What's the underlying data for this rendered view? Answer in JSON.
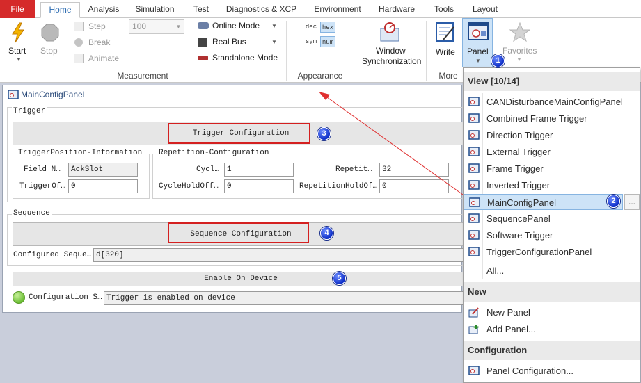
{
  "tabs": [
    "File",
    "Home",
    "Analysis",
    "Simulation",
    "Test",
    "Diagnostics & XCP",
    "Environment",
    "Hardware",
    "Tools",
    "Layout"
  ],
  "ribbon": {
    "start": "Start",
    "stop": "Stop",
    "step": "Step",
    "break": "Break",
    "animate": "Animate",
    "speed_value": "100",
    "online_mode": "Online Mode",
    "real_bus": "Real Bus",
    "standalone_mode": "Standalone Mode",
    "group_measurement": "Measurement",
    "fmt_dec": "dec",
    "fmt_hex": "hex",
    "fmt_sym": "sym",
    "fmt_num": "num",
    "group_appearance": "Appearance",
    "window_sync_1": "Window",
    "window_sync_2": "Synchronization",
    "write": "Write",
    "group_more": "More",
    "panel": "Panel",
    "favorites": "Favorites"
  },
  "panel": {
    "title": "MainConfigPanel",
    "trigger_group": "Trigger",
    "trigger_config_btn": "Trigger Configuration",
    "tpi_group": "TriggerPosition-Information",
    "field_n_label": "Field N…",
    "field_n_value": "AckSlot",
    "trigger_of_label": "TriggerOf…",
    "trigger_of_value": "0",
    "rep_group": "Repetition-Configuration",
    "cycl_label": "Cycl…",
    "cycl_value": "1",
    "repetit_label": "Repetit…",
    "repetit_value": "32",
    "cycle_hold_label": "CycleHoldOff…",
    "cycle_hold_value": "0",
    "rep_hold_label": "RepetitionHoldOf…",
    "rep_hold_value": "0",
    "sequence_group": "Sequence",
    "sequence_config_btn": "Sequence Configuration",
    "configured_seq_label": "Configured Seque…",
    "configured_seq_value": "d[320]",
    "enable_btn": "Enable On Device",
    "config_status_label": "Configuration S…",
    "config_status_value": "Trigger is enabled on device"
  },
  "menu": {
    "view_header": "View [10/14]",
    "view_items": [
      "CANDisturbanceMainConfigPanel",
      "Combined Frame Trigger",
      "Direction Trigger",
      "External Trigger",
      "Frame Trigger",
      "Inverted Trigger",
      "MainConfigPanel",
      "SequencePanel",
      "Software Trigger",
      "TriggerConfigurationPanel"
    ],
    "all": "All...",
    "ellipsis": "...",
    "new_header": "New",
    "new_panel": "New Panel",
    "add_panel": "Add Panel...",
    "config_header": "Configuration",
    "panel_config": "Panel Configuration..."
  },
  "badges": [
    "1",
    "2",
    "3",
    "4",
    "5"
  ],
  "colors": {
    "accent": "#2a6ab0",
    "file_tab": "#d52a2a",
    "annotation": "#d42020",
    "badge": "#1030c8",
    "status_led": "#7ac943"
  }
}
